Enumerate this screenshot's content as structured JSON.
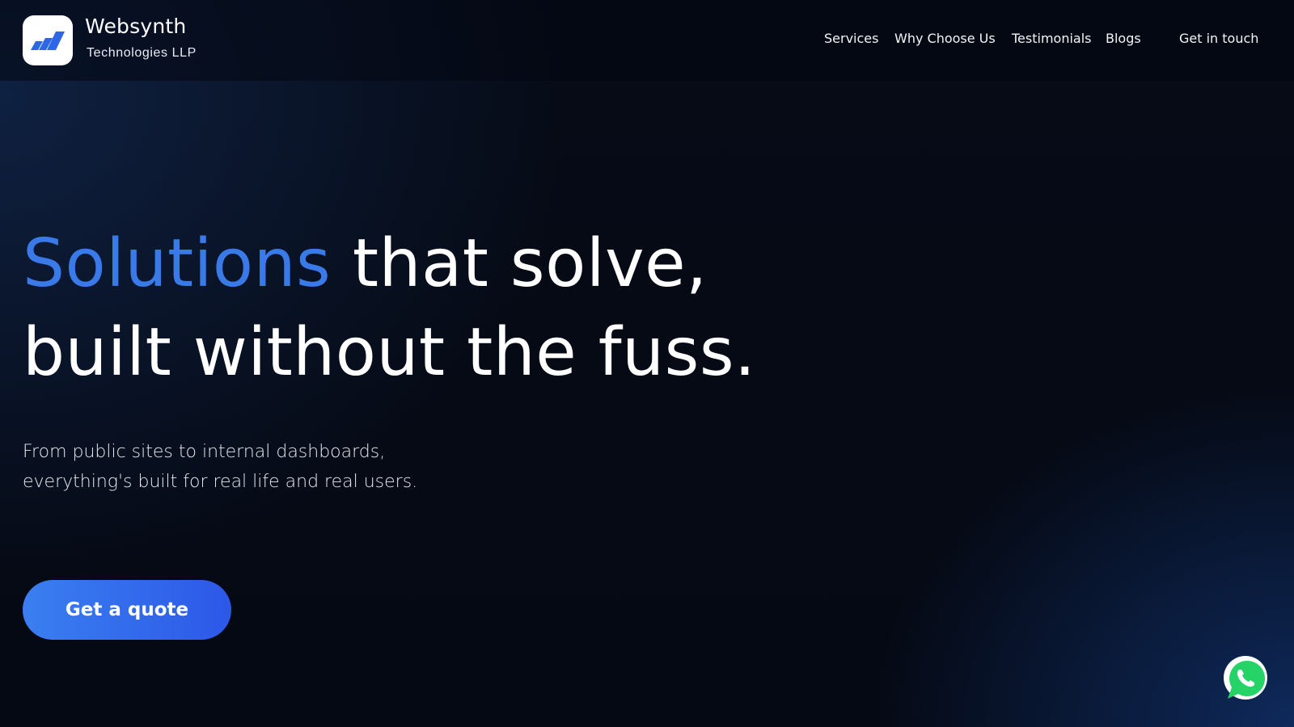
{
  "brand": {
    "name": "Websynth",
    "subtitle": "Technologies LLP",
    "logo_icon": "websynth-logo-icon"
  },
  "nav": {
    "items": [
      "Services",
      "Why Choose Us",
      "Testimonials",
      "Blogs"
    ],
    "cta": "Get in touch"
  },
  "hero": {
    "title_accent": "Solutions",
    "title_rest_line1": " that solve,",
    "title_line2": "built without the fuss.",
    "subtitle_line1": "From public sites to internal dashboards,",
    "subtitle_line2": "everything's built for real life and real users.",
    "button_label": "Get a quote"
  },
  "floating": {
    "whatsapp_icon": "whatsapp-icon"
  },
  "colors": {
    "background": "#050914",
    "accent": "#3a7ae8",
    "button_gradient_start": "#3a7ff0",
    "button_gradient_end": "#2c58e8",
    "whatsapp_green": "#25d366"
  }
}
